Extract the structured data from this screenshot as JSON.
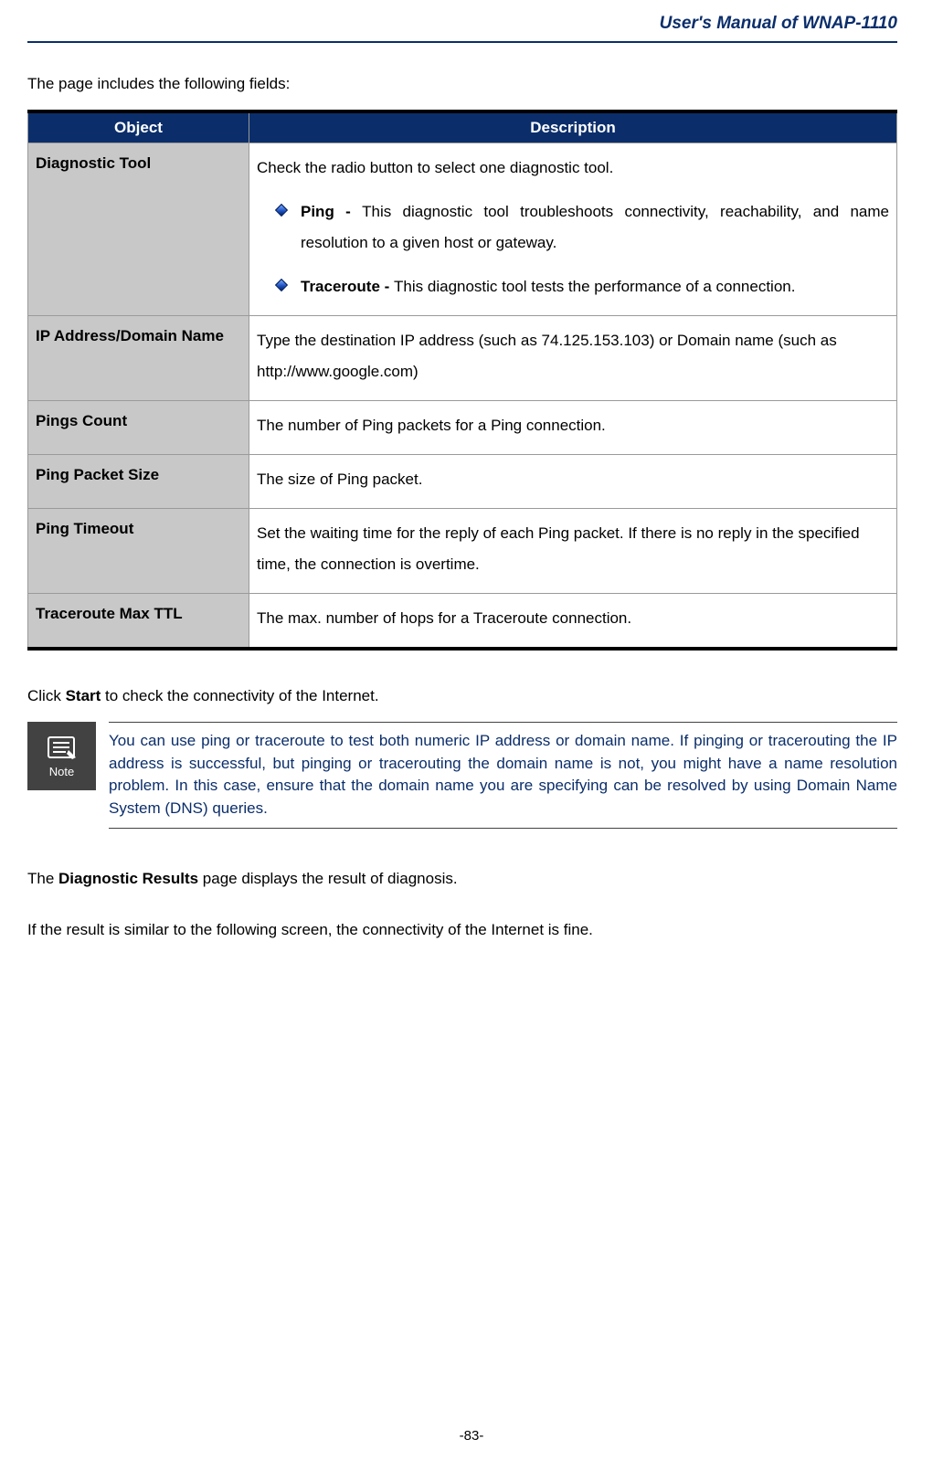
{
  "header": {
    "title": "User's Manual of WNAP-1110"
  },
  "intro": "The page includes the following fields:",
  "table": {
    "headers": {
      "object": "Object",
      "description": "Description"
    },
    "rows": [
      {
        "object": "Diagnostic Tool",
        "desc_intro": "Check the radio button to select one diagnostic tool.",
        "bullets": [
          {
            "label": "Ping - ",
            "text": "This diagnostic tool troubleshoots connectivity, reachability, and name resolution to a given host or gateway."
          },
          {
            "label": "Traceroute - ",
            "text": "This diagnostic tool tests the performance of a connection."
          }
        ]
      },
      {
        "object": "IP Address/Domain Name",
        "desc": "Type the destination IP address (such as 74.125.153.103) or Domain name (such as http://www.google.com)"
      },
      {
        "object": "Pings Count",
        "desc": "The number of Ping packets for a Ping connection."
      },
      {
        "object": "Ping Packet Size",
        "desc": "The size of Ping packet."
      },
      {
        "object": "Ping Timeout",
        "desc": "Set the waiting time for the reply of each Ping packet. If there is no reply in the specified time, the connection is overtime."
      },
      {
        "object": "Traceroute Max TTL",
        "desc": "The max. number of hops for a Traceroute connection."
      }
    ]
  },
  "click_start": {
    "pre": "Click ",
    "bold": "Start",
    "post": " to check the connectivity of the Internet."
  },
  "note": {
    "label": "Note",
    "text": "You can use ping or traceroute to test both numeric IP address or domain name. If pinging or tracerouting the IP address is successful, but pinging or tracerouting the domain name is not, you might have a name resolution problem. In this case, ensure that the domain name you are specifying can be resolved by using Domain Name System (DNS) queries."
  },
  "post_note": {
    "line1": {
      "pre": "The ",
      "bold": "Diagnostic Results",
      "post": " page displays the result of diagnosis."
    },
    "line2": "If the result is similar to the following screen, the connectivity of the Internet is fine."
  },
  "page_number": "-83-"
}
